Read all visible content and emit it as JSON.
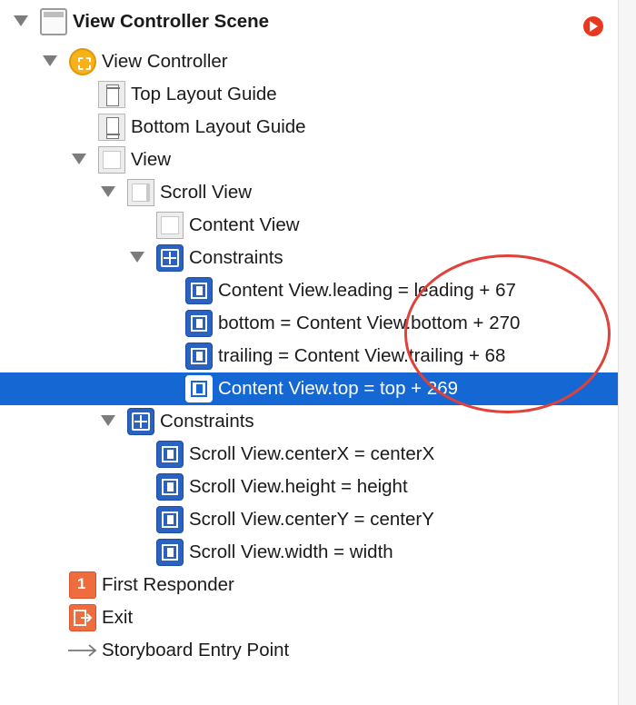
{
  "scene": {
    "title": "View Controller Scene"
  },
  "view_controller": {
    "label": "View Controller"
  },
  "top_layout_guide": {
    "label": "Top Layout Guide"
  },
  "bottom_layout_guide": {
    "label": "Bottom Layout Guide"
  },
  "view": {
    "label": "View"
  },
  "scroll_view": {
    "label": "Scroll View"
  },
  "content_view": {
    "label": "Content View"
  },
  "inner_constraints": {
    "label": "Constraints",
    "items": [
      "Content View.leading = leading + 67",
      "bottom = Content View.bottom + 270",
      "trailing = Content View.trailing + 68",
      "Content View.top = top + 269"
    ]
  },
  "outer_constraints": {
    "label": "Constraints",
    "items": [
      "Scroll View.centerX = centerX",
      "Scroll View.height = height",
      "Scroll View.centerY = centerY",
      "Scroll View.width = width"
    ]
  },
  "first_responder": {
    "label": "First Responder",
    "badge": "1"
  },
  "exit": {
    "label": "Exit"
  },
  "entry_point": {
    "label": "Storyboard Entry Point"
  },
  "colors": {
    "selection": "#1567d3",
    "constraint_icon": "#2a62c1",
    "view_controller_icon": "#f7b21b",
    "proxy_icon": "#ef6c3e",
    "annotation_circle": "#e0413b",
    "warning_arrow": "#e8391f"
  },
  "icons": {
    "scene": "scene-icon",
    "view_controller": "view-controller-icon",
    "layout_guide": "layout-guide-icon",
    "view": "view-icon",
    "constraints": "constraints-icon",
    "constraint": "constraint-icon",
    "first_responder": "first-responder-icon",
    "exit": "exit-icon",
    "entry_point": "arrow-right-icon",
    "scene_warning": "warning-arrow-icon"
  },
  "selected_row": "Content View.top = top + 269"
}
